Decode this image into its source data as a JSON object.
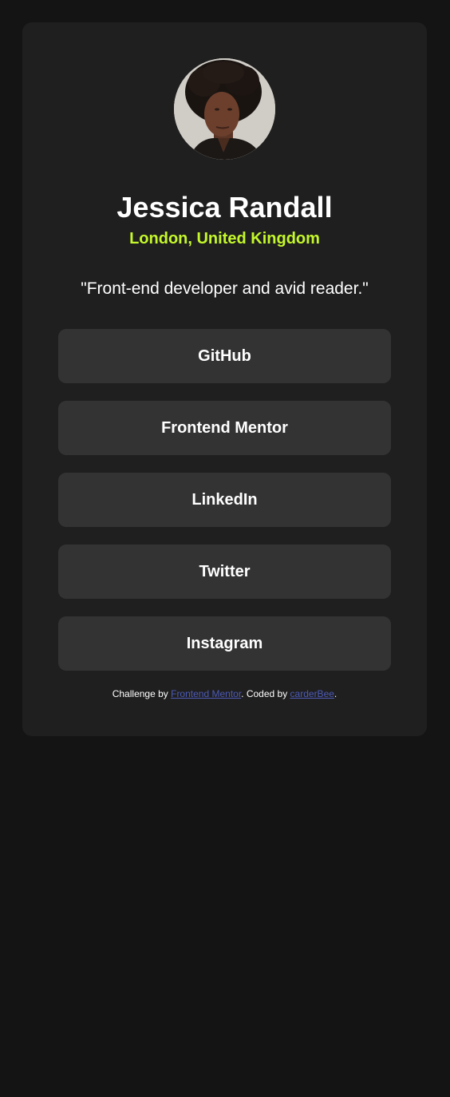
{
  "profile": {
    "name": "Jessica Randall",
    "location": "London, United Kingdom",
    "bio": "\"Front-end developer and avid reader.\""
  },
  "links": [
    {
      "label": "GitHub"
    },
    {
      "label": "Frontend Mentor"
    },
    {
      "label": "LinkedIn"
    },
    {
      "label": "Twitter"
    },
    {
      "label": "Instagram"
    }
  ],
  "attribution": {
    "prefix": "Challenge by ",
    "challenge_link": "Frontend Mentor",
    "middle": ". Coded by ",
    "author_link": "carderBee",
    "suffix": "."
  },
  "colors": {
    "page_background": "#141414",
    "card_background": "#1f1f1f",
    "button_background": "#333333",
    "accent": "#c4f82a",
    "link": "#4d5bb8"
  },
  "avatar": {
    "icon": "profile-photo"
  }
}
